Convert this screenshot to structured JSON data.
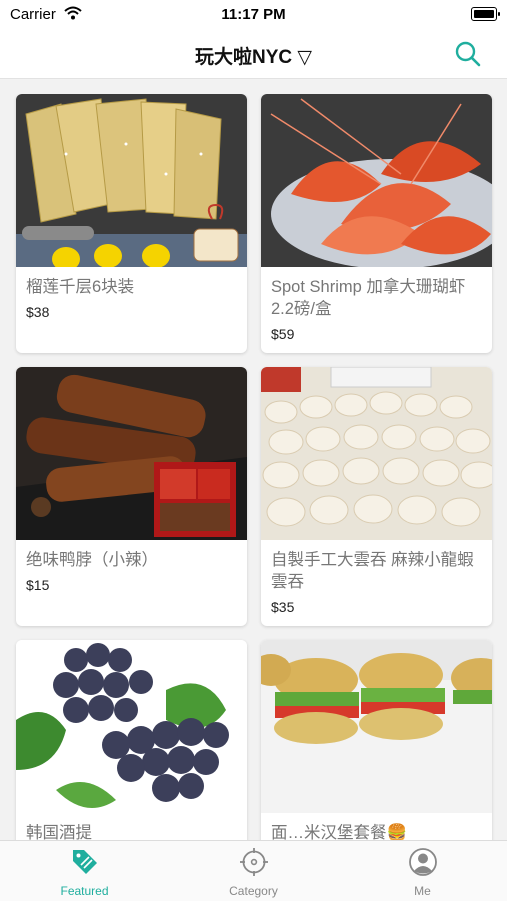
{
  "status_bar": {
    "carrier": "Carrier",
    "time": "11:17 PM"
  },
  "header": {
    "title": "玩大啦NYC ▽"
  },
  "products": [
    {
      "name": "榴莲千层6块装",
      "price": "$38"
    },
    {
      "name": "Spot Shrimp 加拿大珊瑚虾 2.2磅/盒",
      "price": "$59"
    },
    {
      "name": "绝味鸭脖（小辣）",
      "price": "$15"
    },
    {
      "name": "自製手工大雲吞 麻辣小龍蝦雲吞",
      "price": "$35"
    },
    {
      "name": "韩国酒提",
      "price": ""
    },
    {
      "name": "面…米汉堡套餐🍔",
      "price": ""
    }
  ],
  "tabs": [
    {
      "label": "Featured",
      "icon": "featured-tag-icon",
      "active": true
    },
    {
      "label": "Category",
      "icon": "category-compass-icon",
      "active": false
    },
    {
      "label": "Me",
      "icon": "profile-icon",
      "active": false
    }
  ],
  "colors": {
    "accent": "#1fae9e",
    "inactive": "#888888"
  }
}
